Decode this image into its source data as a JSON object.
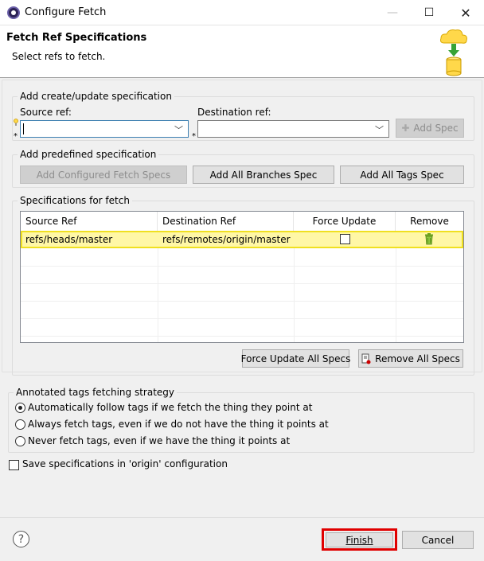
{
  "window": {
    "title": "Configure Fetch",
    "minimize_glyph": "—",
    "maximize_glyph": "☐",
    "close_glyph": "✕"
  },
  "header": {
    "title": "Fetch Ref Specifications",
    "subtitle": "Select refs to fetch."
  },
  "create_group": {
    "legend": "Add create/update specification",
    "source_label": "Source ref:",
    "source_value": "",
    "destination_label": "Destination ref:",
    "destination_value": "",
    "required_marker": "*",
    "add_spec_label": "Add Spec"
  },
  "predefined_group": {
    "legend": "Add predefined specification",
    "buttons": [
      "Add Configured Fetch Specs",
      "Add All Branches Spec",
      "Add All Tags Spec"
    ]
  },
  "specs_group": {
    "legend": "Specifications for fetch",
    "columns": [
      "Source Ref",
      "Destination Ref",
      "Force Update",
      "Remove"
    ],
    "rows": [
      {
        "source": "refs/heads/master",
        "destination": "refs/remotes/origin/master",
        "force_update": false
      }
    ],
    "force_update_all_label": "Force Update All Specs",
    "remove_all_label": "Remove All Specs"
  },
  "tags_group": {
    "legend": "Annotated tags fetching strategy",
    "options": [
      "Automatically follow tags if we fetch the thing they point at",
      "Always fetch tags, even if we do not have the thing it points at",
      "Never fetch tags, even if we have the thing it points at"
    ],
    "selected_index": 0
  },
  "save_checkbox_label": "Save specifications in 'origin' configuration",
  "save_checked": false,
  "footer": {
    "help_glyph": "?",
    "finish_label": "Finish",
    "cancel_label": "Cancel"
  },
  "colors": {
    "highlight_row": "#fff7a6",
    "highlight_border": "#f0e020",
    "finish_outline": "#e00000"
  }
}
